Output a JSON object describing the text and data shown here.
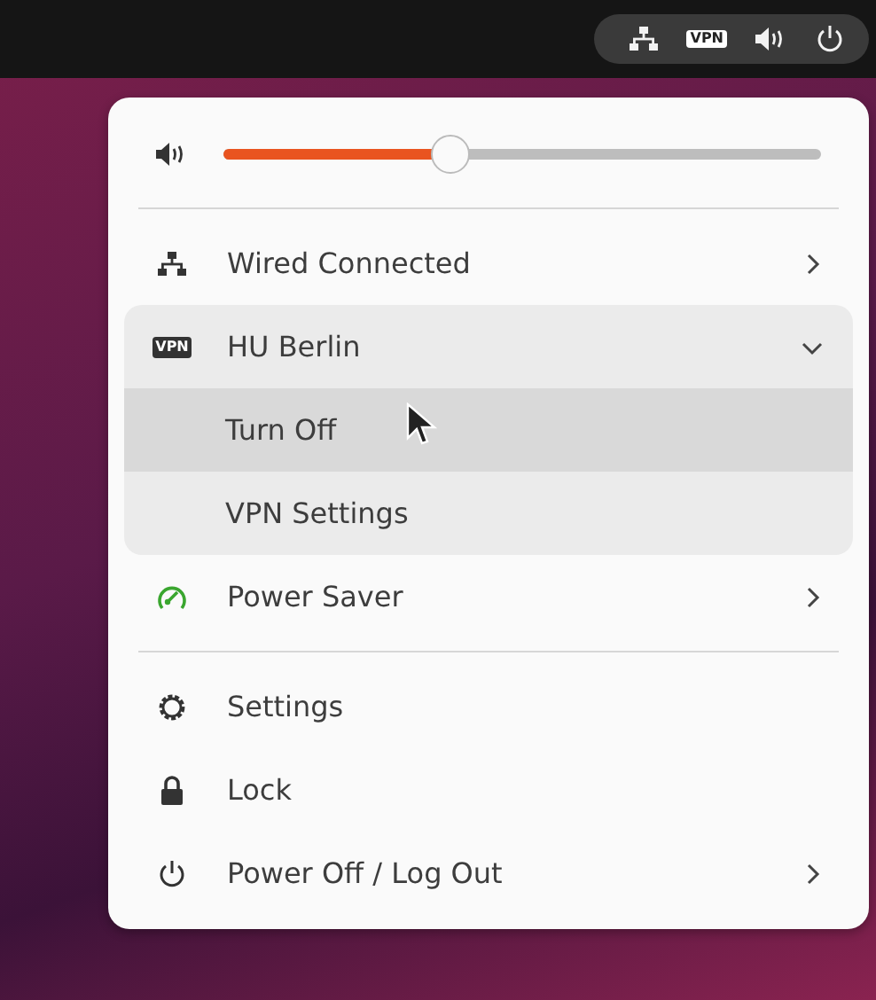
{
  "top_bar": {
    "tray": [
      {
        "kind": "network"
      },
      {
        "kind": "vpn",
        "text": "VPN"
      },
      {
        "kind": "volume"
      },
      {
        "kind": "power"
      }
    ]
  },
  "menu": {
    "volume": {
      "level": 0.38
    },
    "sections": [
      [
        {
          "kind": "network",
          "label": "Wired Connected",
          "submenu": true,
          "expanded": false
        },
        {
          "kind": "vpn",
          "icon_text": "VPN",
          "label": "HU Berlin",
          "submenu": true,
          "expanded": true,
          "children": [
            {
              "label": "Turn Off",
              "hovered": true
            },
            {
              "label": "VPN Settings",
              "hovered": false
            }
          ]
        },
        {
          "kind": "power_saver",
          "label": "Power Saver",
          "submenu": true,
          "expanded": false
        }
      ],
      [
        {
          "kind": "settings",
          "label": "Settings",
          "submenu": false,
          "expanded": false
        },
        {
          "kind": "lock",
          "label": "Lock",
          "submenu": false,
          "expanded": false
        },
        {
          "kind": "power",
          "label": "Power Off / Log Out",
          "submenu": true,
          "expanded": false
        }
      ]
    ]
  }
}
